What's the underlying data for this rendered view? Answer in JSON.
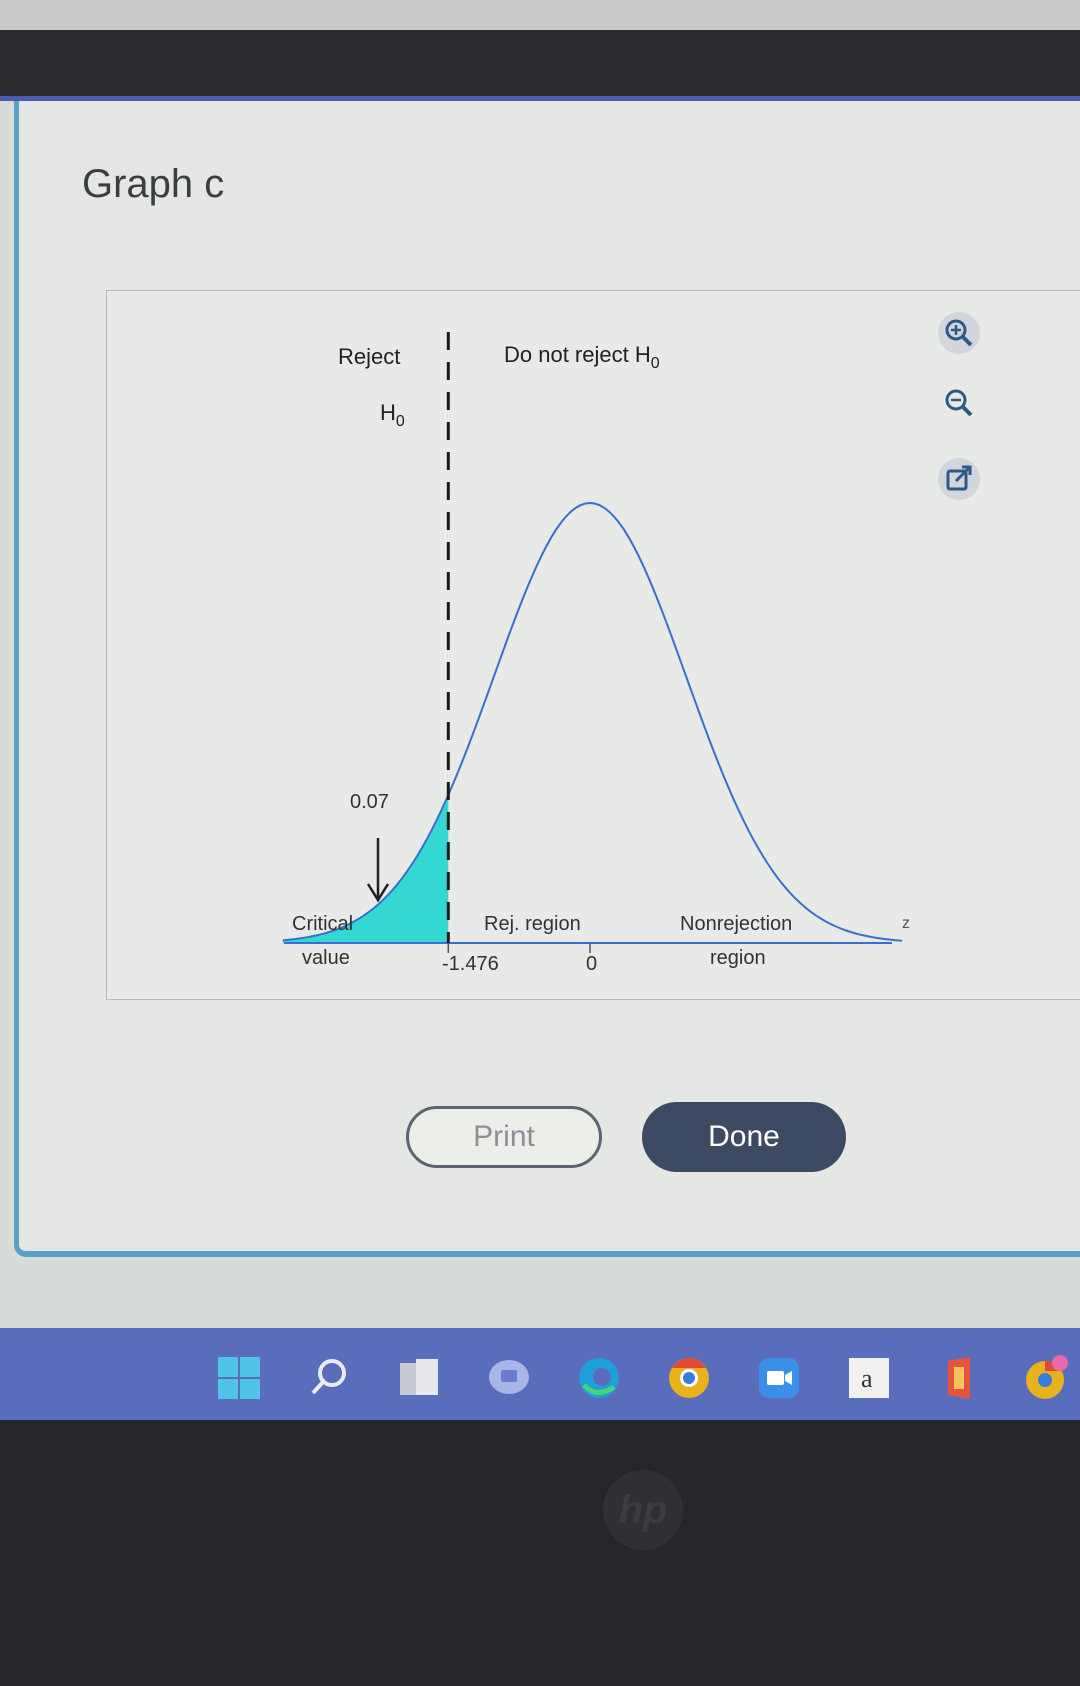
{
  "dialog": {
    "title": "Graph c",
    "print_label": "Print",
    "done_label": "Done"
  },
  "graph": {
    "reject_label": "Reject",
    "reject_h0": "H",
    "reject_h0_sub": "0",
    "do_not_reject_label": "Do not reject H",
    "do_not_reject_sub": "0",
    "area_label": "0.07",
    "critical_label": "Critical",
    "value_label": "value",
    "rej_region_label": "Rej. region",
    "nonrejection_label": "Nonrejection",
    "region_label": "region",
    "critical_value_tick": "-1.476",
    "zero_tick": "0",
    "axis_label": "z"
  },
  "chart_data": {
    "type": "area",
    "distribution": "standard normal",
    "critical_value": -1.476,
    "tail": "left",
    "tail_area": 0.07,
    "xlabel": "z",
    "colors": {
      "curve": "#3a6fd0",
      "shade": "#35d7d2",
      "dashed_line": "#1a1a1a"
    }
  },
  "taskbar": {
    "icons": [
      "windows-start-icon",
      "search-icon",
      "file-explorer-icon",
      "chat-icon",
      "edge-browser-icon",
      "chrome-icon",
      "zoom-icon",
      "amazon-icon",
      "office-icon",
      "chrome-profile-icon"
    ],
    "amazon_letter": "a"
  },
  "laptop": {
    "brand": "hp"
  }
}
